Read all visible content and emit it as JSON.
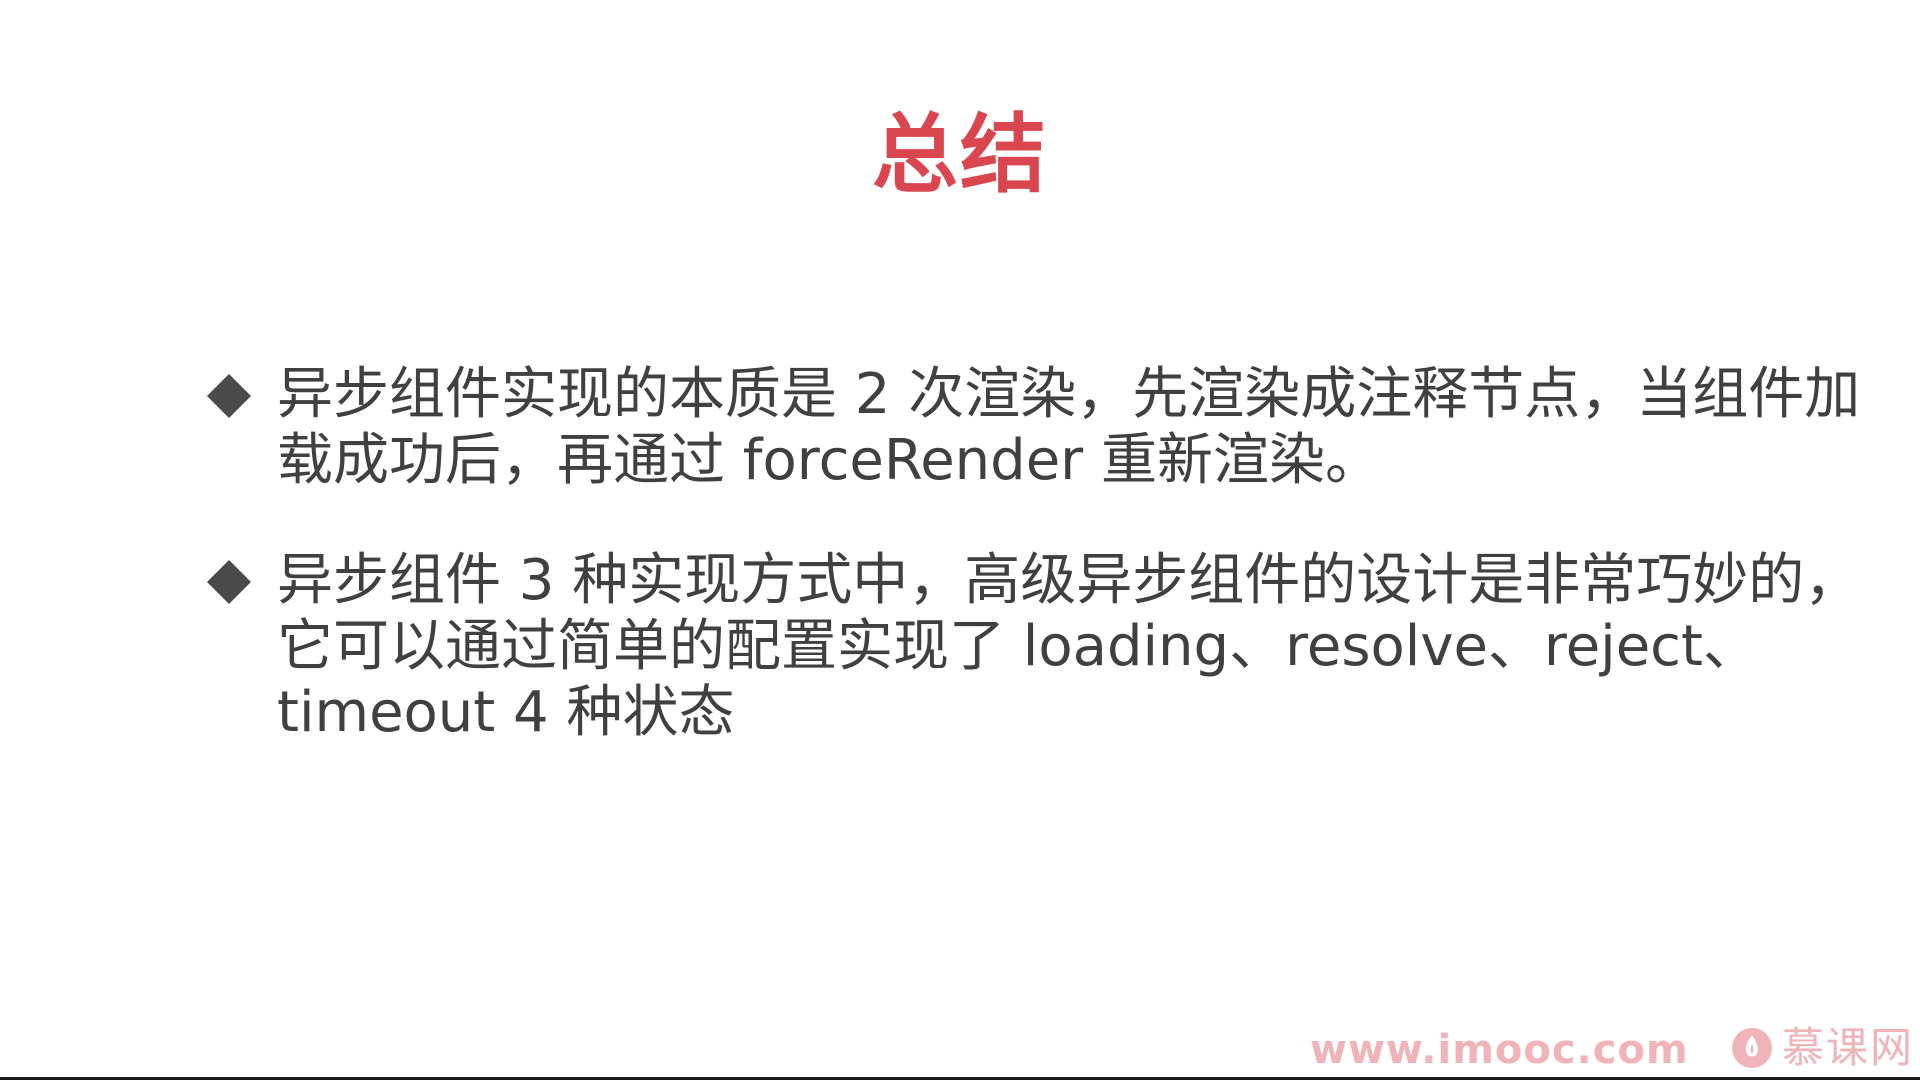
{
  "slide": {
    "title": "总结",
    "bullets": [
      {
        "text": "异步组件实现的本质是 2  次渲染，先渲染成注释节点，当组件加载成功后，再通过 forceRender 重新渲染。"
      },
      {
        "text": "异步组件 3 种实现方式中，高级异步组件的设计是非常巧妙的，它可以通过简单的配置实现了 loading、resolve、reject、timeout 4 种状态"
      }
    ]
  },
  "watermark": {
    "url": "www.imooc.com",
    "brand": "慕课网",
    "logo_icon": "flame-logo-icon"
  },
  "colors": {
    "title": "#d9464f",
    "text": "#404040",
    "bullet_marker": "#4a4a4a",
    "watermark": "#f0b4b8"
  }
}
